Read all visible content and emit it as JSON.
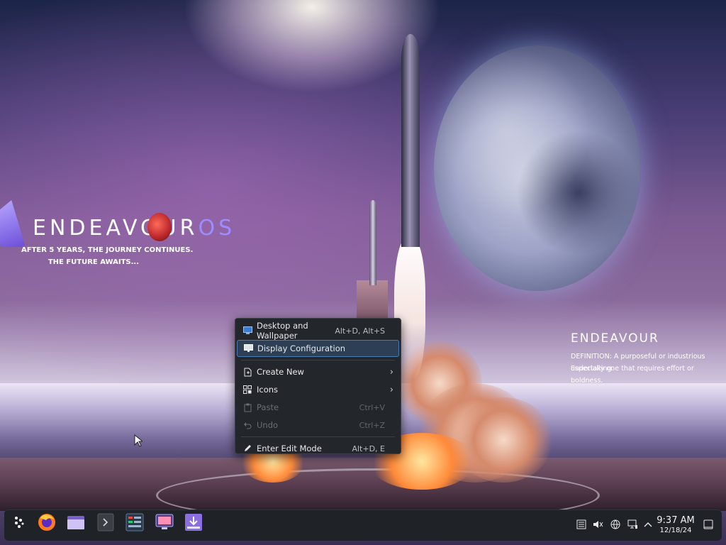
{
  "wallpaper": {
    "brand": "ENDEAVOUR",
    "brand_suffix": "OS",
    "tagline_line1": "AFTER 5 YEARS, THE JOURNEY CONTINUES.",
    "tagline_line2": "THE FUTURE AWAITS...",
    "definition_title": "ENDEAVOUR",
    "definition_line1": "DEFINITION: A purposeful or industrious undertaking.",
    "definition_line2": "Especially one that requires effort or boldness."
  },
  "context_menu": {
    "items": [
      {
        "label": "Desktop and Wallpaper",
        "shortcut": "Alt+D, Alt+S",
        "icon": "desktop-wallpaper-icon"
      },
      {
        "label": "Display Configuration",
        "shortcut": "",
        "icon": "monitor-icon",
        "highlighted": true
      },
      {
        "label": "Create New",
        "shortcut": "",
        "icon": "new-file-icon",
        "submenu": true
      },
      {
        "label": "Icons",
        "shortcut": "",
        "icon": "grid-icon",
        "submenu": true
      },
      {
        "label": "Paste",
        "shortcut": "Ctrl+V",
        "icon": "paste-icon",
        "disabled": true
      },
      {
        "label": "Undo",
        "shortcut": "Ctrl+Z",
        "icon": "undo-icon",
        "disabled": true
      },
      {
        "label": "Enter Edit Mode",
        "shortcut": "Alt+D, E",
        "icon": "pencil-icon"
      }
    ],
    "submenu_arrow": "›"
  },
  "taskbar": {
    "launchers": [
      {
        "name": "application-launcher",
        "icon": "endeavour-launcher-icon"
      },
      {
        "name": "firefox",
        "icon": "firefox-icon"
      },
      {
        "name": "file-manager",
        "icon": "folder-icon"
      },
      {
        "name": "terminal",
        "icon": "terminal-icon"
      },
      {
        "name": "system-monitor",
        "icon": "system-monitor-icon"
      },
      {
        "name": "display-settings",
        "icon": "display-settings-icon"
      },
      {
        "name": "software-installer",
        "icon": "download-icon"
      }
    ],
    "clock": {
      "time": "9:37 AM",
      "date": "12/18/24"
    },
    "tray_expand": "^"
  },
  "colors": {
    "menu_bg": "#23262b",
    "menu_highlight": "#2d3f55",
    "menu_highlight_border": "#4a7ab6",
    "taskbar_bg": "#1f2226",
    "brand_accent": "#9d8cff"
  }
}
